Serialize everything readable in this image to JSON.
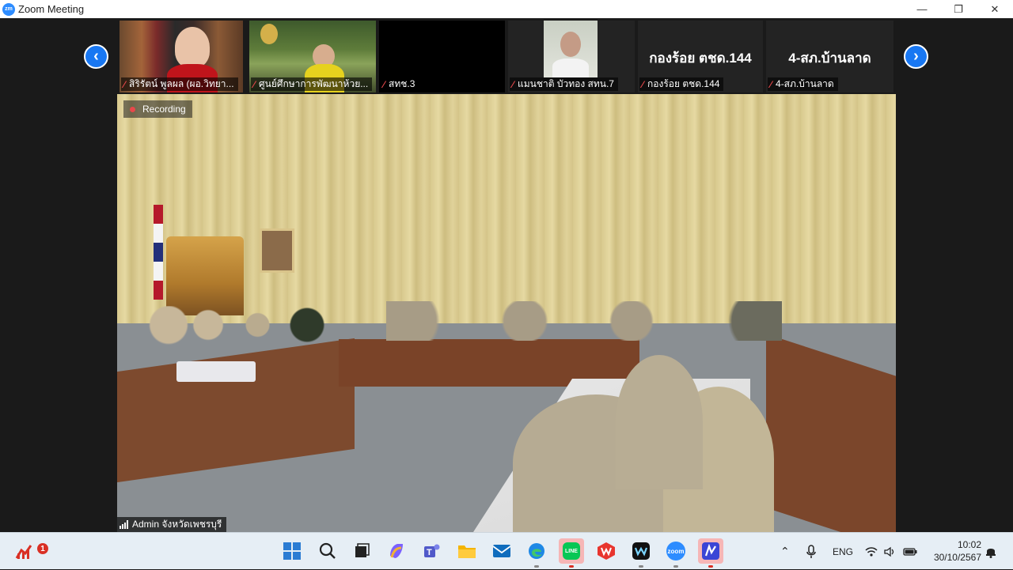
{
  "window": {
    "title": "Zoom Meeting",
    "app_icon_text": "zm",
    "minimize": "—",
    "maximize": "❐",
    "close": "✕"
  },
  "gallery": {
    "prev_glyph": "‹",
    "next_glyph": "›",
    "tiles": [
      {
        "name": "สิริรัตน์  พูลผล (ผอ.วิทยา...",
        "big_label": ""
      },
      {
        "name": "ศูนย์ศึกษาการพัฒนาห้วย...",
        "big_label": ""
      },
      {
        "name": "สทช.3",
        "big_label": ""
      },
      {
        "name": "แมนชาติ บัวทอง สทน.7",
        "big_label": ""
      },
      {
        "name": "กองร้อย ตชด.144",
        "big_label": "กองร้อย ตชด.144"
      },
      {
        "name": "4-สภ.บ้านลาด",
        "big_label": "4-สภ.บ้านลาด"
      }
    ]
  },
  "main_video": {
    "recording_label": "Recording",
    "speaker_label": "Admin จังหวัดเพชรบุรี"
  },
  "taskbar": {
    "notification_count": "1",
    "language": "ENG",
    "time": "10:02",
    "date": "30/10/2567",
    "apps": [
      "windows-start",
      "search",
      "task-view",
      "copilot",
      "teams",
      "file-explorer",
      "mail",
      "edge",
      "line",
      "wps",
      "webex",
      "zoom",
      "miro"
    ],
    "app_labels": {
      "line": "LINE",
      "zoom": "zoom"
    }
  },
  "colors": {
    "zoom_blue": "#1877f2",
    "recording_red": "#e8484b",
    "mic_muted_red": "#e8484b"
  }
}
